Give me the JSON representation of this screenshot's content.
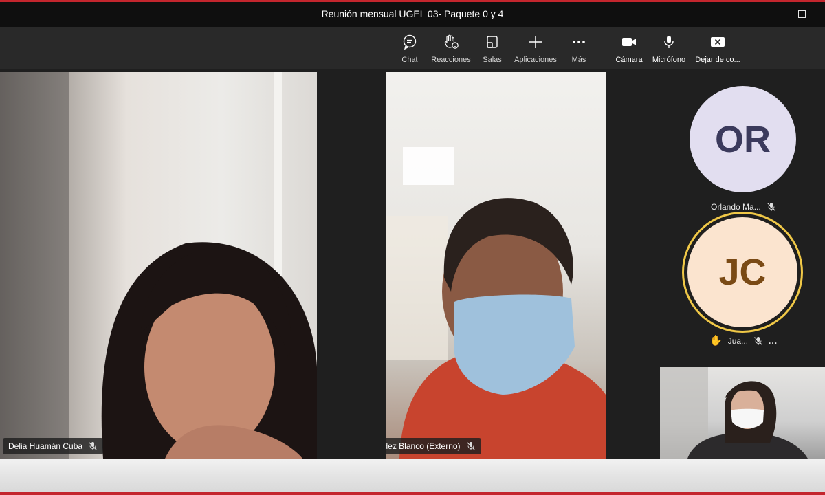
{
  "window": {
    "title": "Reunión mensual UGEL 03- Paquete 0 y 4"
  },
  "toolbar": {
    "buttons": [
      {
        "label": "Chat",
        "icon": "chat-icon"
      },
      {
        "label": "Reacciones",
        "icon": "raise-hand-icon"
      },
      {
        "label": "Salas",
        "icon": "breakout-rooms-icon"
      },
      {
        "label": "Aplicaciones",
        "icon": "plus-icon"
      },
      {
        "label": "Más",
        "icon": "more-icon"
      },
      {
        "label": "Cámara",
        "icon": "camera-icon"
      },
      {
        "label": "Micrófono",
        "icon": "microphone-icon"
      },
      {
        "label": "Dejar de co...",
        "icon": "stop-sharing-icon"
      }
    ]
  },
  "participants": {
    "delia": {
      "name": "Delia Huamán Cuba",
      "muted": true
    },
    "godofredo": {
      "name": "Godofredo Valdez Blanco (Externo)",
      "muted": true
    },
    "orlando": {
      "initials": "OR",
      "name": "Orlando Ma...",
      "muted": true,
      "avatar_bg": "#e2def0",
      "avatar_fg": "#3b3a5c"
    },
    "juan": {
      "initials": "JC",
      "name": "Jua...",
      "muted": true,
      "hand_raised": true,
      "more": "...",
      "avatar_bg": "#fbe4cf",
      "avatar_fg": "#7a4a15",
      "ring_color": "#f0c847"
    }
  },
  "colors": {
    "accent": "#c4262e",
    "toolbar_bg": "#292929",
    "titlebar_bg": "#0f0f0f",
    "stage_bg": "#1f1f1f"
  }
}
